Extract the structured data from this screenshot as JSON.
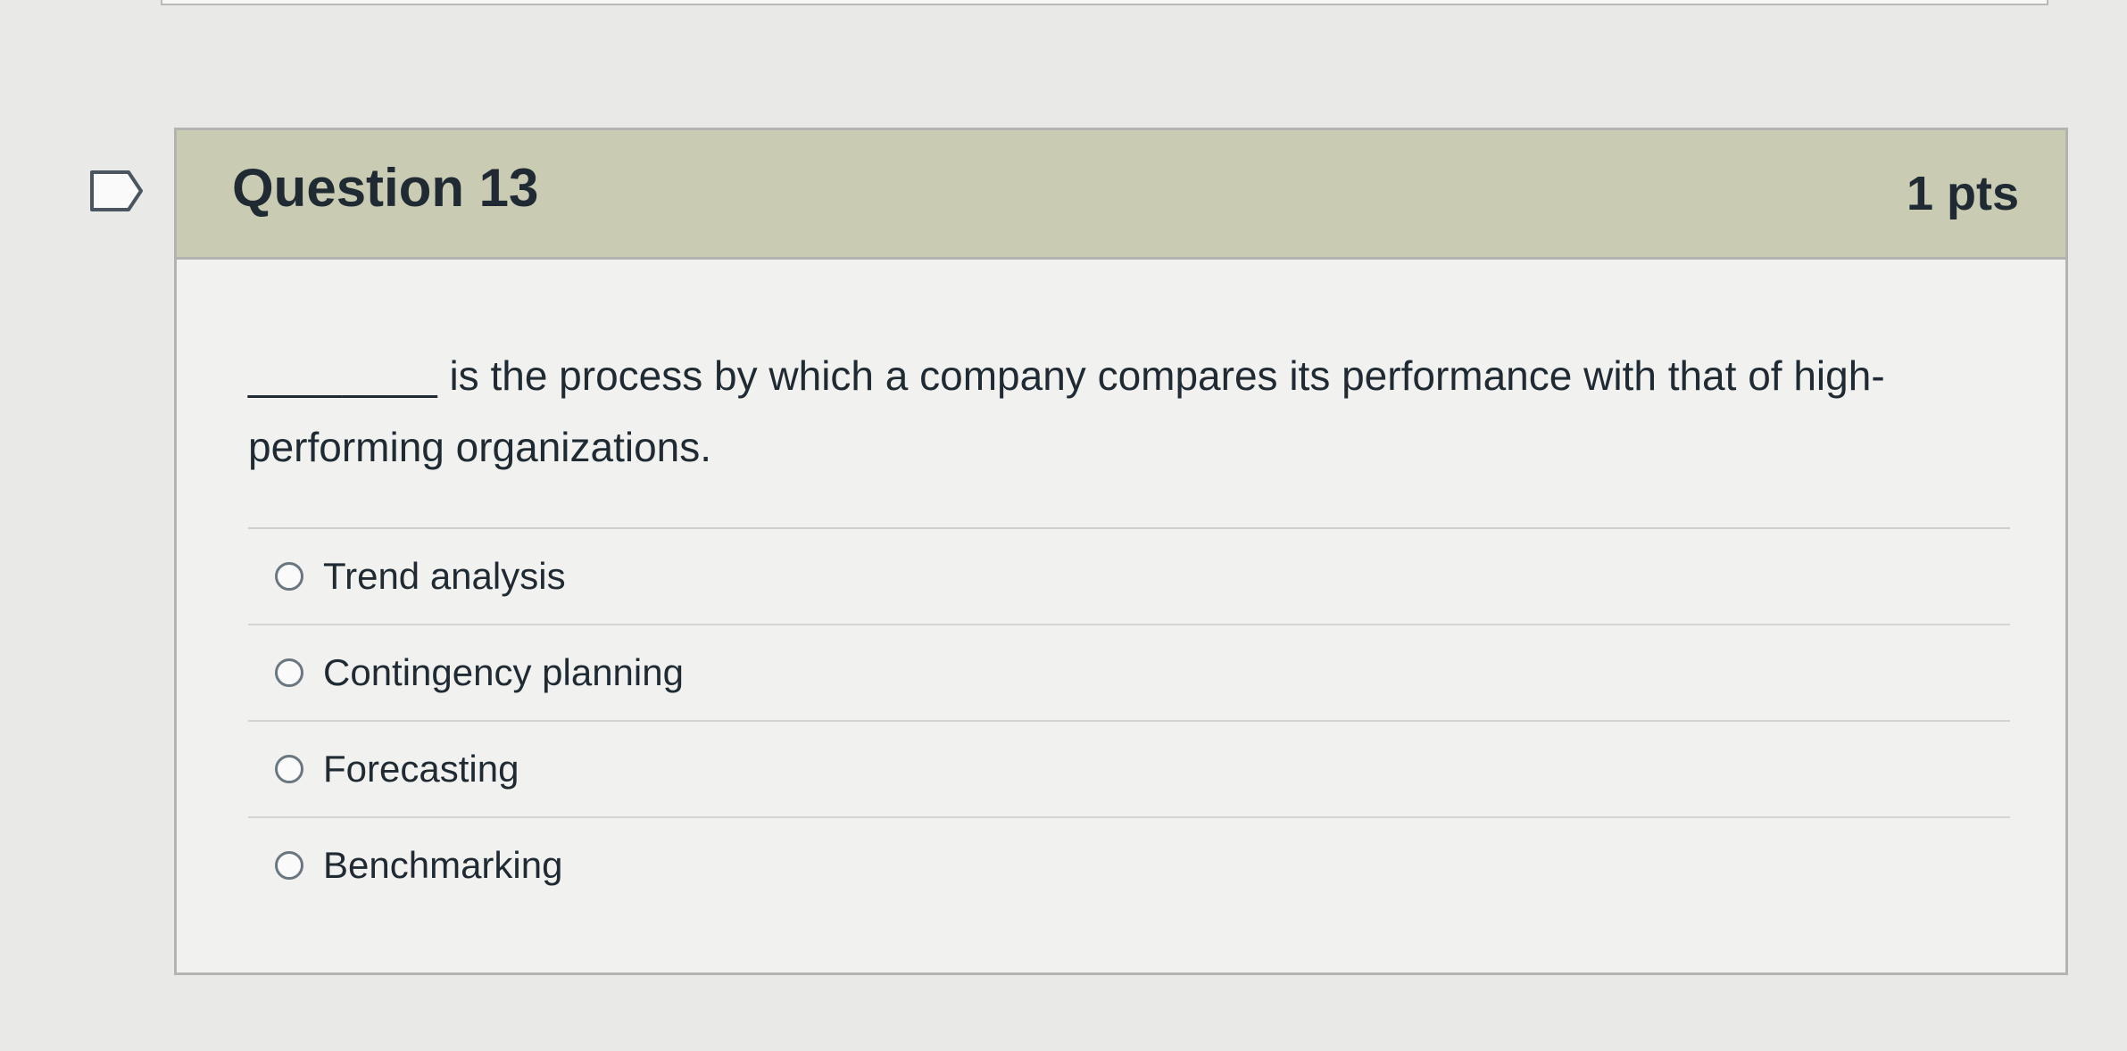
{
  "question": {
    "title": "Question 13",
    "points": "1 pts",
    "blank": "________",
    "text": " is the process by which a company compares its performance with that of high-performing organizations.",
    "answers": [
      "Trend analysis",
      "Contingency planning",
      "Forecasting",
      "Benchmarking"
    ]
  },
  "icons": {
    "flag": "bookmark-flag-icon",
    "radio": "radio-button-icon"
  },
  "colors": {
    "header_bg": "#c9cbb3",
    "card_bg": "#f1f1ef",
    "page_bg": "#e9e9e7",
    "text": "#1f2a33"
  }
}
